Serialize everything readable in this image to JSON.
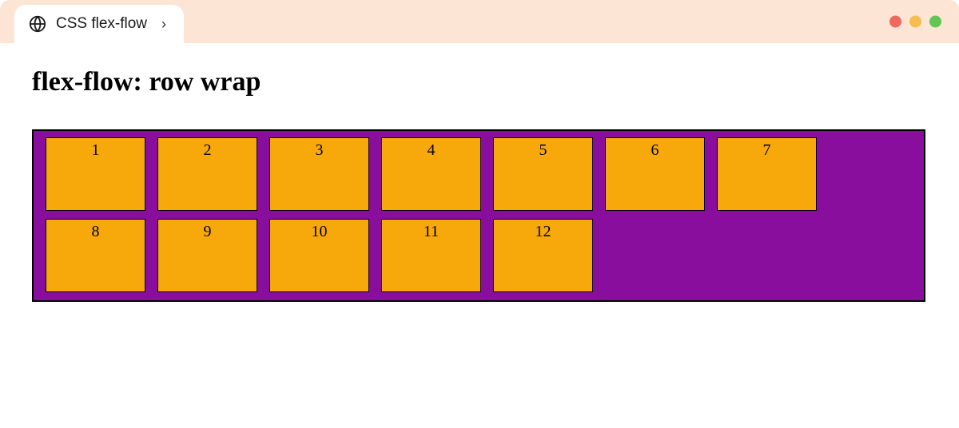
{
  "tab": {
    "title": "CSS flex-flow"
  },
  "heading": "flex-flow: row wrap",
  "items": {
    "0": "1",
    "1": "2",
    "2": "3",
    "3": "4",
    "4": "5",
    "5": "6",
    "6": "7",
    "7": "8",
    "8": "9",
    "9": "10",
    "10": "11",
    "11": "12"
  },
  "colors": {
    "chrome_bg": "#fce5d4",
    "container_bg": "#8a0e9e",
    "item_bg": "#f7a80a",
    "dot_red": "#ee6a5f",
    "dot_yellow": "#f5be4f",
    "dot_green": "#62c554"
  }
}
